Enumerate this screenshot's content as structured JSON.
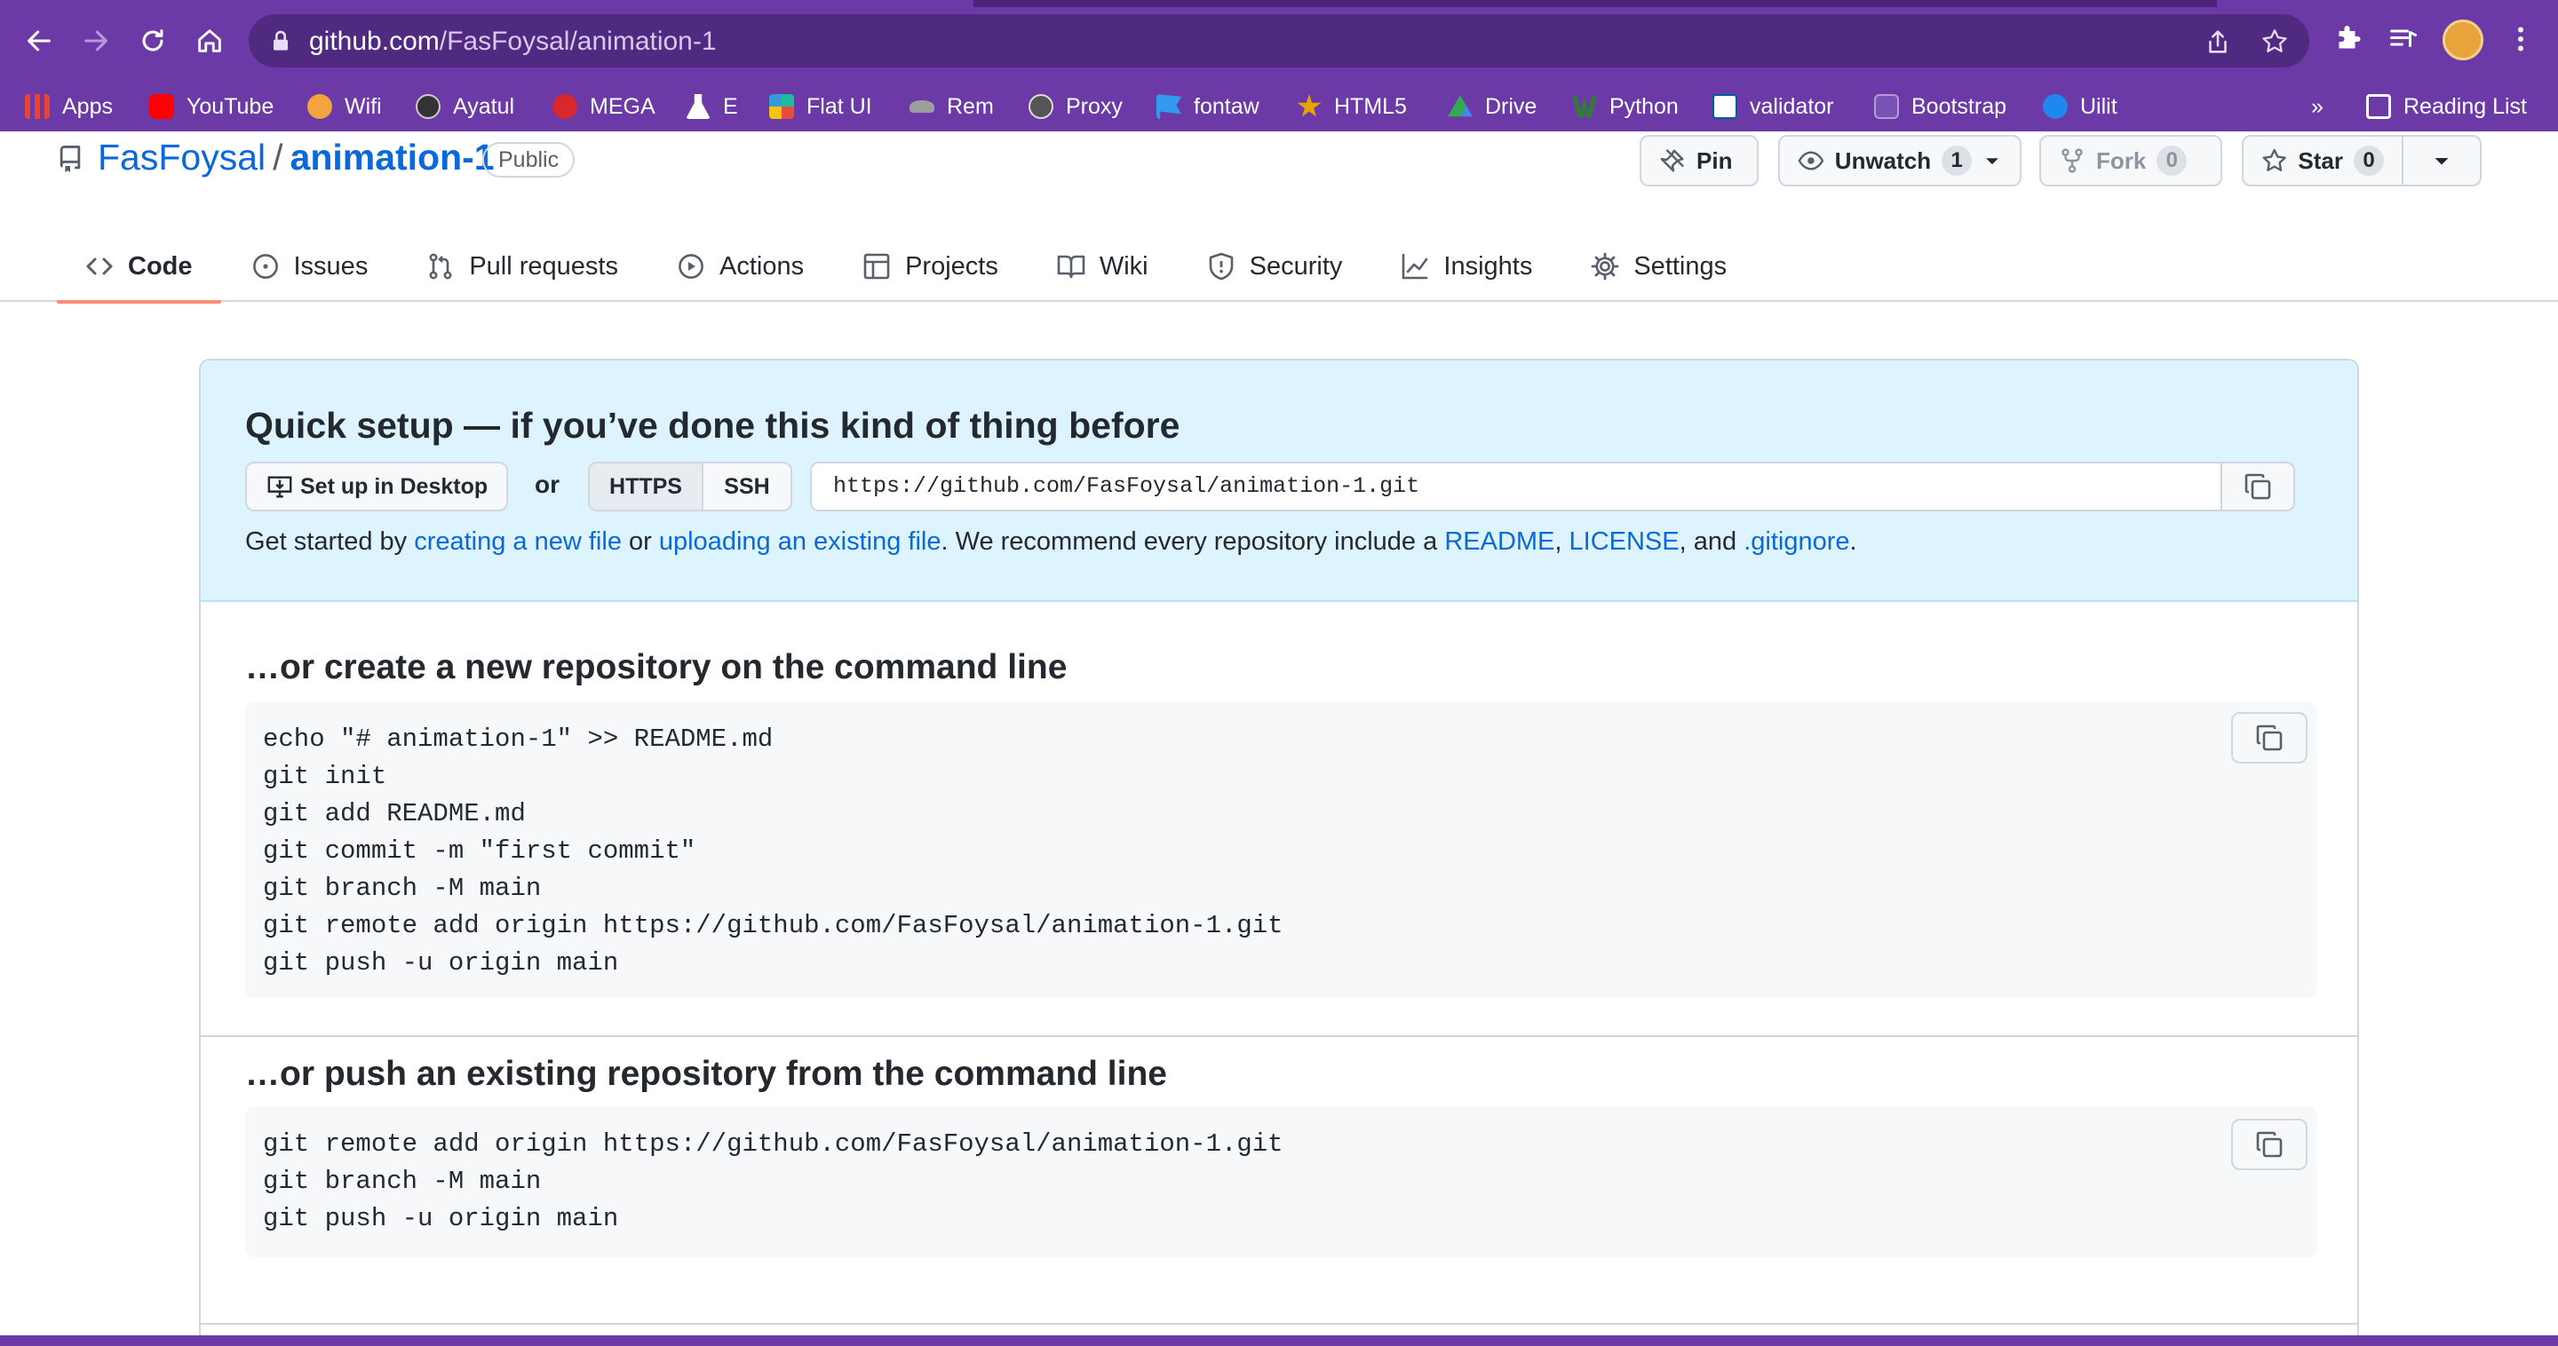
{
  "browser": {
    "url_host": "github.com",
    "url_path": "/FasFoysal/animation-1",
    "bookmarks": [
      {
        "label": "Apps",
        "color": "#ea4335"
      },
      {
        "label": "YouTube",
        "color": "#ff0000"
      },
      {
        "label": "Wifi",
        "color": "#f4a340"
      },
      {
        "label": "Ayatul",
        "color": "#333333"
      },
      {
        "label": "MEGA",
        "color": "#d9272e"
      },
      {
        "label": "E",
        "color": "#ffffff"
      },
      {
        "label": "Flat UI",
        "color": "#1abc9c"
      },
      {
        "label": "Rem",
        "color": "#9e9e9e"
      },
      {
        "label": "Proxy",
        "color": "#555555"
      },
      {
        "label": "fontaw",
        "color": "#339af0"
      },
      {
        "label": "HTML5",
        "color": "#e8a400"
      },
      {
        "label": "Drive",
        "color": "#34a853"
      },
      {
        "label": "Python",
        "color": "#2e7d32"
      },
      {
        "label": "validator",
        "color": "#005a9c"
      },
      {
        "label": "Bootstrap",
        "color": "#7952b3"
      },
      {
        "label": "Uilit",
        "color": "#1e87f0"
      }
    ],
    "more_label": "»",
    "reading_list": "Reading List"
  },
  "repo": {
    "owner": "FasFoysal",
    "separator": "/",
    "name": "animation-1",
    "visibility": "Public",
    "pin_label": "Pin",
    "unwatch_label": "Unwatch",
    "unwatch_count": "1",
    "fork_label": "Fork",
    "fork_count": "0",
    "star_label": "Star",
    "star_count": "0"
  },
  "tabs": [
    {
      "label": "Code",
      "icon": "code-icon",
      "active": true
    },
    {
      "label": "Issues",
      "icon": "issue-icon"
    },
    {
      "label": "Pull requests",
      "icon": "pull-request-icon"
    },
    {
      "label": "Actions",
      "icon": "play-icon"
    },
    {
      "label": "Projects",
      "icon": "table-icon"
    },
    {
      "label": "Wiki",
      "icon": "book-icon"
    },
    {
      "label": "Security",
      "icon": "shield-icon"
    },
    {
      "label": "Insights",
      "icon": "graph-icon"
    },
    {
      "label": "Settings",
      "icon": "gear-icon"
    }
  ],
  "quick_setup": {
    "title": "Quick setup — if you’ve done this kind of thing before",
    "desktop_button": "Set up in Desktop",
    "or": "or",
    "https": "HTTPS",
    "ssh": "SSH",
    "clone_url": "https://github.com/FasFoysal/animation-1.git",
    "text_1": "Get started by ",
    "link_new_file": "creating a new file",
    "text_2": " or ",
    "link_upload": "uploading an existing file",
    "text_3": ". We recommend every repository include a ",
    "link_readme": "README",
    "text_4": ", ",
    "link_license": "LICENSE",
    "text_5": ", and ",
    "link_gitignore": ".gitignore",
    "text_6": "."
  },
  "new_repo": {
    "title": "…or create a new repository on the command line",
    "lines": [
      "echo \"# animation-1\" >> README.md",
      "git init",
      "git add README.md",
      "git commit -m \"first commit\"",
      "git branch -M main",
      "git remote add origin https://github.com/FasFoysal/animation-1.git",
      "git push -u origin main"
    ]
  },
  "push_existing": {
    "title": "…or push an existing repository from the command line",
    "lines": [
      "git remote add origin https://github.com/FasFoysal/animation-1.git",
      "git branch -M main",
      "git push -u origin main"
    ]
  },
  "colors": {
    "browser_chrome": "#6c3aa6",
    "link": "#0969da",
    "active_tab_underline": "#fd8c73",
    "quick_setup_bg": "#ddf4ff"
  }
}
